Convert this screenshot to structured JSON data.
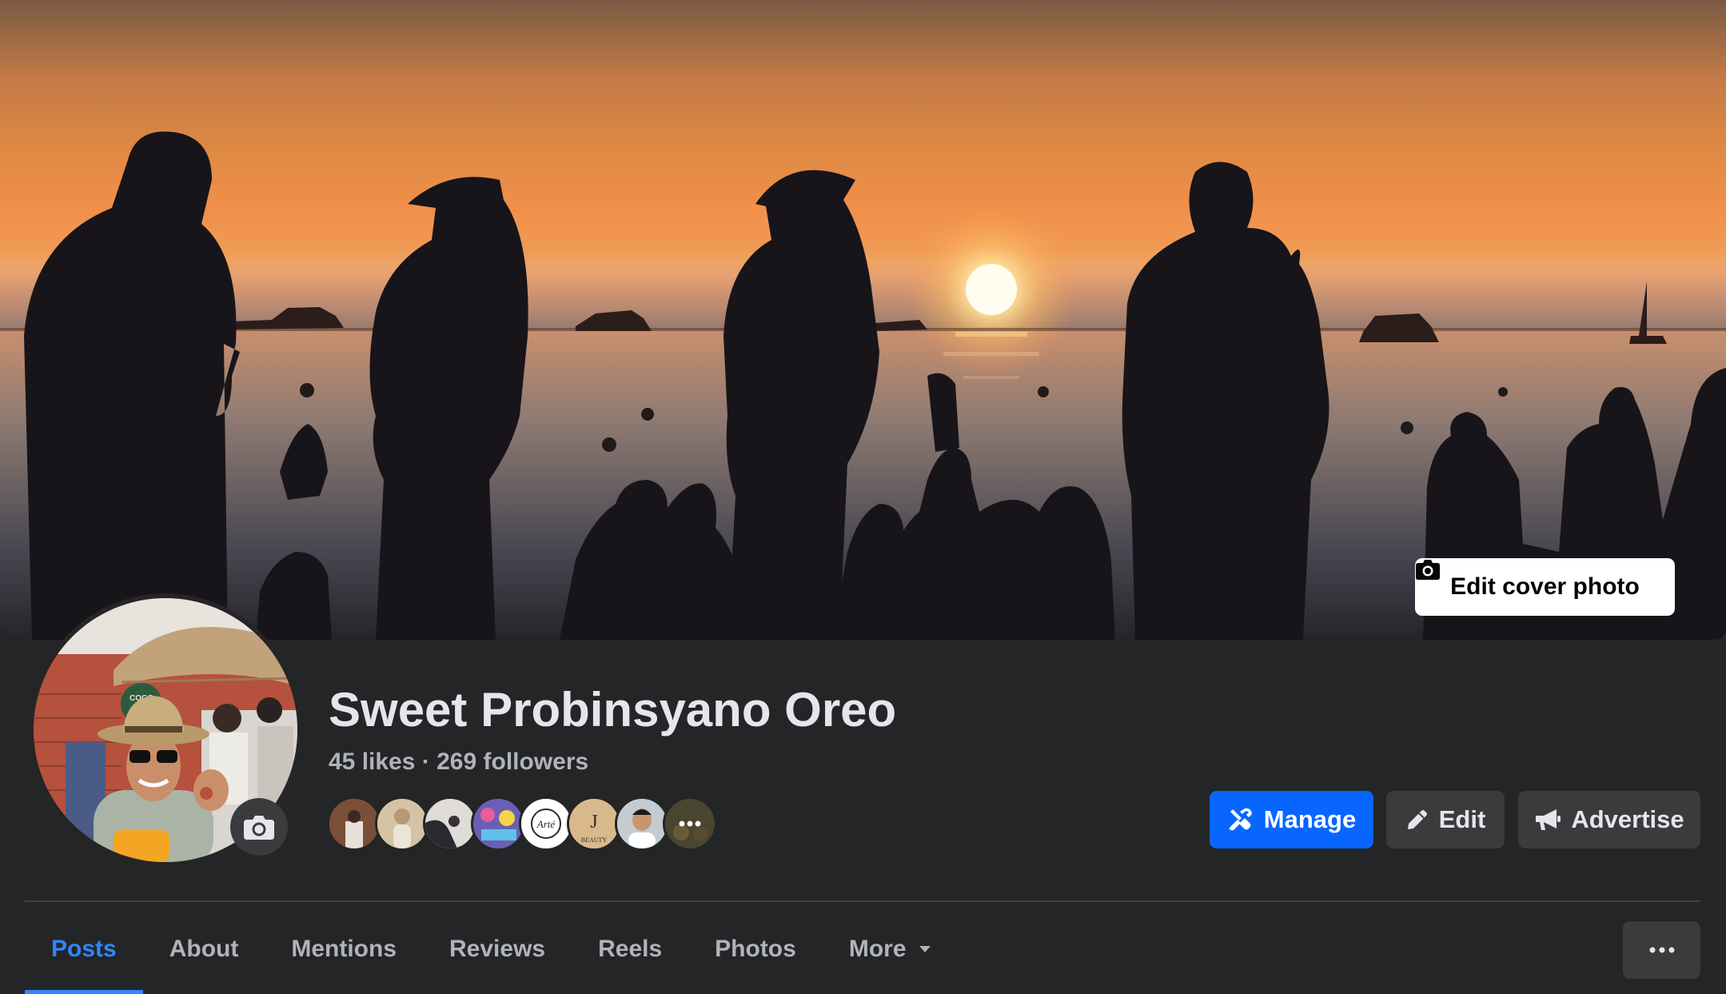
{
  "cover": {
    "edit_label": "Edit cover photo",
    "icon": "camera-icon"
  },
  "profile": {
    "name": "Sweet Probinsyano Oreo",
    "likes": "45 likes",
    "separator": "·",
    "followers": "269 followers",
    "avatar_sign_text": "COCO MAMA",
    "avatar_icon": "camera-icon"
  },
  "follower_avatars": [
    {
      "name": "follower-avatar-1",
      "color": "#8a5a3e"
    },
    {
      "name": "follower-avatar-2",
      "color": "#cdbba0"
    },
    {
      "name": "follower-avatar-3",
      "color": "#d9d4cf"
    },
    {
      "name": "follower-avatar-4",
      "color": "#6f64b8"
    },
    {
      "name": "follower-avatar-5",
      "color": "#ffffff",
      "text": "Arté"
    },
    {
      "name": "follower-avatar-6",
      "color": "#c8a77a",
      "text": "J BEAUTY"
    },
    {
      "name": "follower-avatar-7",
      "color": "#c7d0d6"
    },
    {
      "name": "follower-avatar-8",
      "color": "#3d3a2a",
      "text": "•••"
    }
  ],
  "actions": {
    "manage_label": "Manage",
    "manage_icon": "tools-icon",
    "edit_label": "Edit",
    "edit_icon": "pencil-icon",
    "advertise_label": "Advertise",
    "advertise_icon": "megaphone-icon"
  },
  "tabs": [
    {
      "label": "Posts",
      "active": true
    },
    {
      "label": "About"
    },
    {
      "label": "Mentions"
    },
    {
      "label": "Reviews"
    },
    {
      "label": "Reels"
    },
    {
      "label": "Photos"
    },
    {
      "label": "More",
      "icon": "caret-down-icon"
    }
  ],
  "more_options_icon": "more-options-icon",
  "colors": {
    "background": "#242526",
    "primary_button": "#0866ff",
    "secondary_button": "#3a3b3c",
    "active_tab": "#2d88ff",
    "text_primary": "#e4e6eb",
    "text_secondary": "#b0b3b8"
  }
}
